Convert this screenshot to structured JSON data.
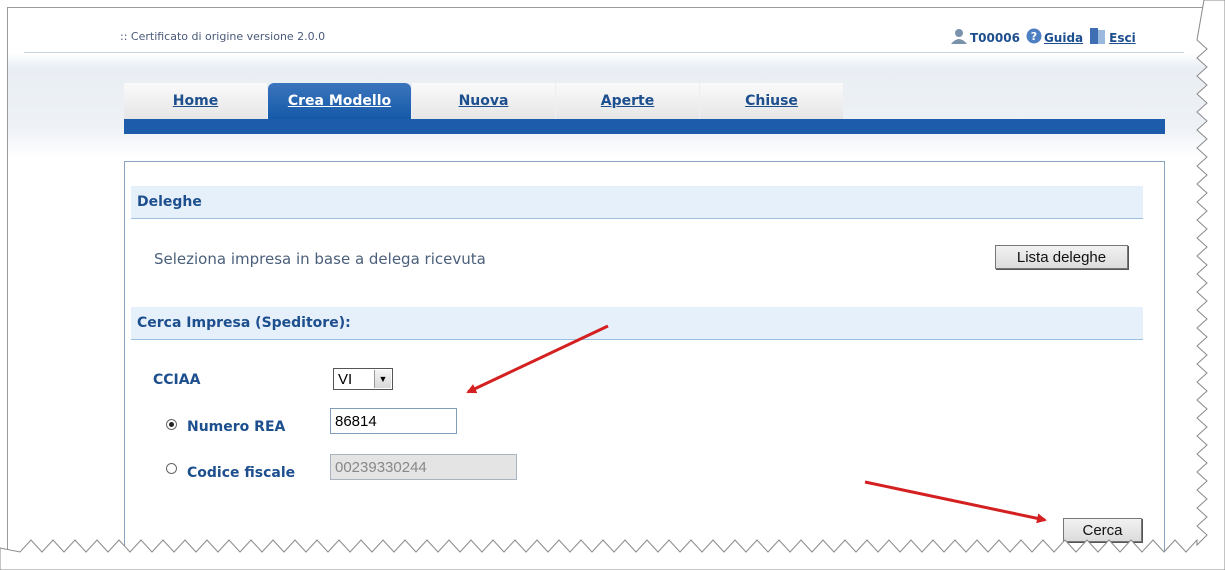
{
  "header": {
    "app_title": ":: Certificato di origine versione 2.0.0",
    "user_id": "T00006",
    "guide_label": "Guida",
    "exit_label": "Esci"
  },
  "tabs": [
    {
      "label": "Home",
      "active": false
    },
    {
      "label": "Crea Modello",
      "active": true
    },
    {
      "label": "Nuova",
      "active": false
    },
    {
      "label": "Aperte",
      "active": false
    },
    {
      "label": "Chiuse",
      "active": false
    }
  ],
  "deleghe": {
    "title": "Deleghe",
    "description": "Seleziona impresa in base a delega ricevuta",
    "button_label": "Lista deleghe"
  },
  "search": {
    "title": "Cerca Impresa (Speditore):",
    "cciaa_label": "CCIAA",
    "cciaa_value": "VI",
    "rea_label": "Numero REA",
    "rea_value": "86814",
    "rea_selected": true,
    "cf_label": "Codice fiscale",
    "cf_value": "00239330244",
    "cf_selected": false,
    "search_button_label": "Cerca"
  },
  "colors": {
    "accent": "#1d5cab",
    "link": "#1d4f8e",
    "section_header_bg": "#e6f0fa",
    "annotation_arrow": "#d42020"
  },
  "icons": [
    "user-icon",
    "help-icon",
    "exit-icon",
    "chevron-down-icon"
  ]
}
